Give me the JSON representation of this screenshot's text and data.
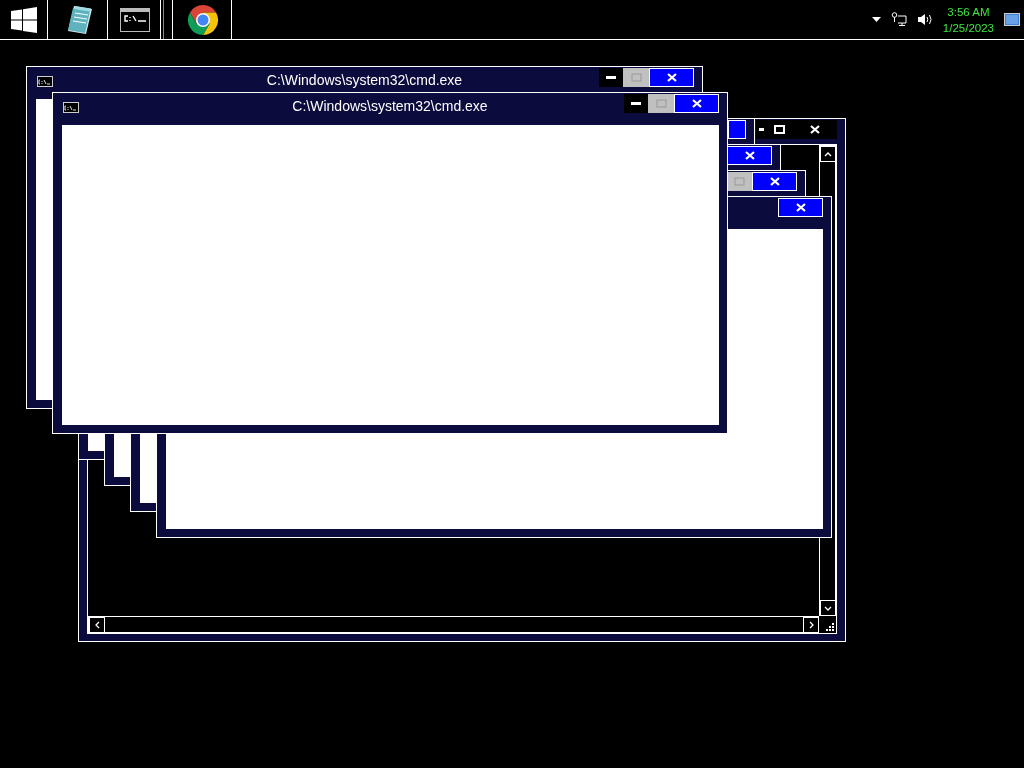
{
  "taskbar": {
    "apps": [
      {
        "kind": "start"
      },
      {
        "kind": "notepad"
      },
      {
        "kind": "console"
      },
      {
        "kind": "browser"
      }
    ],
    "clock": {
      "time": "3:56 AM",
      "date": "1/25/2023"
    }
  },
  "windows": [
    {
      "kind": "scrolling",
      "controls": [
        {
          "kind": "minimize"
        },
        {
          "kind": "maximize",
          "disabled": false
        },
        {
          "kind": "close"
        }
      ]
    },
    {
      "kind": "plain",
      "controls": [
        {
          "kind": "close"
        }
      ]
    },
    {
      "kind": "plain",
      "controls": [
        {
          "kind": "close"
        }
      ]
    },
    {
      "kind": "plain",
      "controls": [
        {
          "kind": "maximize",
          "disabled": true
        },
        {
          "kind": "close"
        }
      ]
    },
    {
      "kind": "plain",
      "controls": [
        {
          "kind": "close"
        }
      ]
    },
    {
      "kind": "plain",
      "title": "C:\\Windows\\system32\\cmd.exe",
      "controls": [
        {
          "kind": "minimize"
        },
        {
          "kind": "maximize",
          "disabled": true
        },
        {
          "kind": "close"
        }
      ]
    },
    {
      "kind": "plain",
      "title": "C:\\Windows\\system32\\cmd.exe",
      "controls": [
        {
          "kind": "minimize"
        },
        {
          "kind": "maximize",
          "disabled": true
        },
        {
          "kind": "close"
        }
      ]
    }
  ]
}
